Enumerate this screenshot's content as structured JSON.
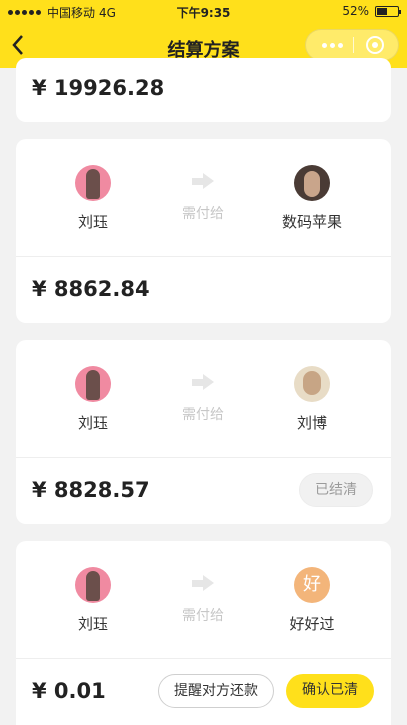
{
  "status_bar": {
    "carrier": "中国移动",
    "network": "4G",
    "time": "下午9:35",
    "battery": "52%",
    "battery_level": 0.52
  },
  "header": {
    "back_icon": "chevron-left-icon",
    "title": "结算方案"
  },
  "partial_card": {
    "amount": "¥ 19926.28"
  },
  "pay_label": "需付给",
  "cards": [
    {
      "from_name": "刘珏",
      "to_name": "数码苹果",
      "amount": "¥ 8862.84"
    },
    {
      "from_name": "刘珏",
      "to_name": "刘博",
      "amount": "¥ 8828.57",
      "status_button": "已结清"
    },
    {
      "from_name": "刘珏",
      "to_name": "好好过",
      "to_avatar_letter": "好",
      "amount": "¥ 0.01",
      "remind_button": "提醒对方还款",
      "confirm_button": "确认已清"
    }
  ],
  "colors": {
    "brand_yellow": "#ffe01b",
    "background": "#f2f2f2"
  }
}
